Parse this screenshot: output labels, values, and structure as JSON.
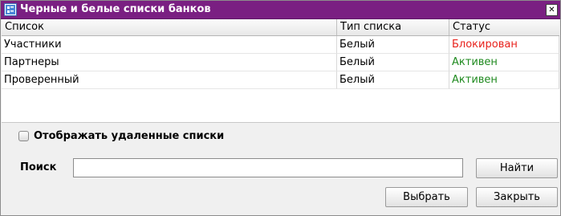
{
  "window": {
    "title": "Черные и белые списки банков",
    "close_glyph": "✕",
    "colors": {
      "titlebar": "#7a1f82",
      "blocked": "#e8221c",
      "active": "#1f8a1f"
    }
  },
  "table": {
    "columns": [
      "Список",
      "Тип списка",
      "Статус"
    ],
    "rows": [
      {
        "name": "Участники",
        "type": "Белый",
        "status": "Блокирован",
        "status_kind": "blocked"
      },
      {
        "name": "Партнеры",
        "type": "Белый",
        "status": "Активен",
        "status_kind": "active"
      },
      {
        "name": "Проверенный",
        "type": "Белый",
        "status": "Активен",
        "status_kind": "active"
      }
    ]
  },
  "options": {
    "show_deleted_label": "Отображать удаленные списки",
    "show_deleted_checked": false
  },
  "search": {
    "label": "Поиск",
    "value": "",
    "find_label": "Найти"
  },
  "footer": {
    "select_label": "Выбрать",
    "close_label": "Закрыть"
  }
}
